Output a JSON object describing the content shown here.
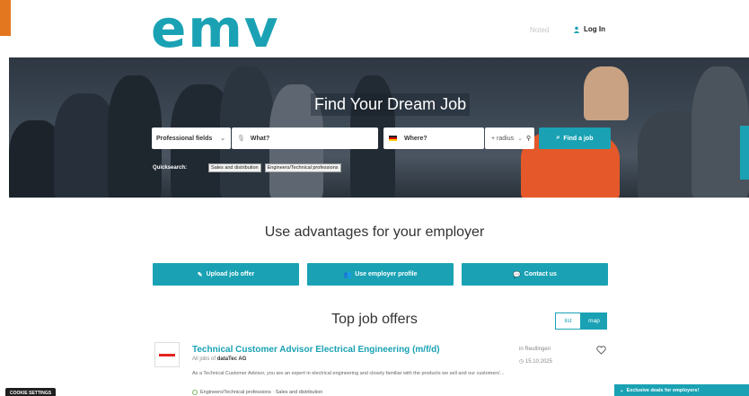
{
  "header": {
    "logo": "emv",
    "noted_label": "Noted",
    "login_label": "Log In"
  },
  "hero": {
    "title": "Find Your Dream Job",
    "search": {
      "professional_fields_label": "Professional fields",
      "what_placeholder": "What?",
      "where_placeholder": "Where?",
      "radius_label": "+ radius",
      "find_button": "Find a job"
    },
    "quicksearch": {
      "label": "Quicksearch:",
      "chips": [
        "Sales and distribution",
        "Engineers/Technical professions"
      ]
    }
  },
  "advantages": {
    "title": "Use advantages for your employer",
    "buttons": [
      "Upload job offer",
      "Use employer profile",
      "Contact us"
    ]
  },
  "top_jobs": {
    "title": "Top job offers",
    "view_toggle": [
      "list",
      "map"
    ],
    "jobs": [
      {
        "title": "Technical Customer Advisor Electrical Engineering (m/f/d)",
        "company_prefix": "All jobs of",
        "company": "dataTec AG",
        "description": "As a Technical Customer Advisor, you are an expert in electrical engineering and closely familiar with the products we sell and our customers'...",
        "location": "in Reutlingen",
        "date": "15.10.2025",
        "tags": "Engineers/Technical professions · Sales and distribution"
      }
    ]
  },
  "footer": {
    "cookie_settings": "COOKIE SETTINGS",
    "deals_label": "Exclusive deals for employers!"
  },
  "colors": {
    "brand": "#1aa2b4",
    "accent": "#e3771f"
  }
}
